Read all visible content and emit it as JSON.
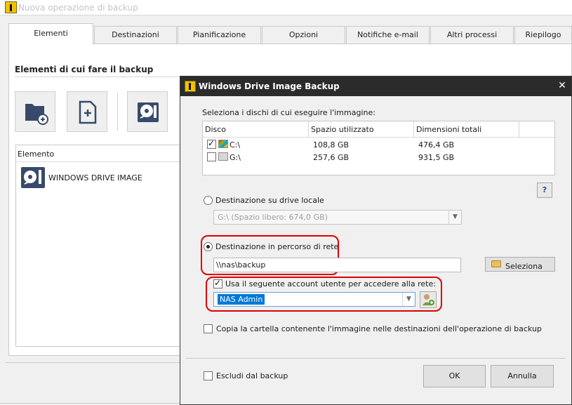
{
  "main_window": {
    "title": "Nuova operazione di backup",
    "tabs": [
      {
        "label": "Elementi",
        "active": true
      },
      {
        "label": "Destinazioni"
      },
      {
        "label": "Pianificazione"
      },
      {
        "label": "Opzioni"
      },
      {
        "label": "Notifiche e-mail"
      },
      {
        "label": "Altri processi"
      },
      {
        "label": "Riepilogo"
      }
    ],
    "section_title": "Elementi di cui fare il backup",
    "toolbar": {
      "add_folder_icon": "folder-add-icon",
      "add_file_icon": "file-add-icon",
      "drive_image_icon": "drive-image-icon"
    },
    "items_header": "Elemento",
    "items": [
      {
        "label": "WINDOWS DRIVE IMAGE",
        "icon": "drive-image-icon"
      }
    ]
  },
  "dialog": {
    "title": "Windows Drive Image Backup",
    "close_symbol": "✕",
    "disks_prompt": "Seleziona i dischi di cui eseguire l'immagine:",
    "disk_columns": [
      "Disco",
      "Spazio utilizzato",
      "Dimensioni totali"
    ],
    "disks": [
      {
        "name": "C:\\",
        "used": "108,8 GB",
        "total": "476,4 GB",
        "checked": true
      },
      {
        "name": "G:\\",
        "used": "257,6 GB",
        "total": "931,5 GB",
        "checked": false
      }
    ],
    "help_label": "?",
    "local_dest_label": "Destinazione su drive locale",
    "local_drive_value": "G:\\   (Spazio libero: 674,0 GB)",
    "network_dest_label": "Destinazione in percorso di rete",
    "network_path": "\\\\nas\\backup",
    "browse_label": "Seleziona",
    "use_account_label": "Usa il seguente account utente per accedere alla rete:",
    "account_value": "NAS Admin",
    "copy_folder_label": "Copia la cartella contenente l'immagine nelle destinazioni dell'operazione di backup",
    "exclude_label": "Escludi dal backup",
    "ok_label": "OK",
    "cancel_label": "Annulla",
    "highlight_color": "#e00000",
    "selection_color": "#0078d7"
  }
}
